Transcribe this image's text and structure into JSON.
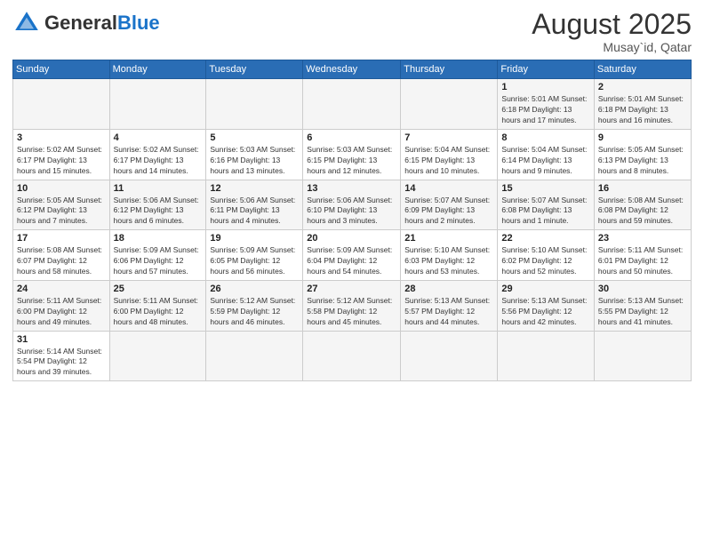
{
  "logo": {
    "text_general": "General",
    "text_blue": "Blue"
  },
  "header": {
    "month": "August 2025",
    "location": "Musay`id, Qatar"
  },
  "weekdays": [
    "Sunday",
    "Monday",
    "Tuesday",
    "Wednesday",
    "Thursday",
    "Friday",
    "Saturday"
  ],
  "weeks": [
    [
      {
        "day": "",
        "info": ""
      },
      {
        "day": "",
        "info": ""
      },
      {
        "day": "",
        "info": ""
      },
      {
        "day": "",
        "info": ""
      },
      {
        "day": "",
        "info": ""
      },
      {
        "day": "1",
        "info": "Sunrise: 5:01 AM\nSunset: 6:18 PM\nDaylight: 13 hours and 17 minutes."
      },
      {
        "day": "2",
        "info": "Sunrise: 5:01 AM\nSunset: 6:18 PM\nDaylight: 13 hours and 16 minutes."
      }
    ],
    [
      {
        "day": "3",
        "info": "Sunrise: 5:02 AM\nSunset: 6:17 PM\nDaylight: 13 hours and 15 minutes."
      },
      {
        "day": "4",
        "info": "Sunrise: 5:02 AM\nSunset: 6:17 PM\nDaylight: 13 hours and 14 minutes."
      },
      {
        "day": "5",
        "info": "Sunrise: 5:03 AM\nSunset: 6:16 PM\nDaylight: 13 hours and 13 minutes."
      },
      {
        "day": "6",
        "info": "Sunrise: 5:03 AM\nSunset: 6:15 PM\nDaylight: 13 hours and 12 minutes."
      },
      {
        "day": "7",
        "info": "Sunrise: 5:04 AM\nSunset: 6:15 PM\nDaylight: 13 hours and 10 minutes."
      },
      {
        "day": "8",
        "info": "Sunrise: 5:04 AM\nSunset: 6:14 PM\nDaylight: 13 hours and 9 minutes."
      },
      {
        "day": "9",
        "info": "Sunrise: 5:05 AM\nSunset: 6:13 PM\nDaylight: 13 hours and 8 minutes."
      }
    ],
    [
      {
        "day": "10",
        "info": "Sunrise: 5:05 AM\nSunset: 6:12 PM\nDaylight: 13 hours and 7 minutes."
      },
      {
        "day": "11",
        "info": "Sunrise: 5:06 AM\nSunset: 6:12 PM\nDaylight: 13 hours and 6 minutes."
      },
      {
        "day": "12",
        "info": "Sunrise: 5:06 AM\nSunset: 6:11 PM\nDaylight: 13 hours and 4 minutes."
      },
      {
        "day": "13",
        "info": "Sunrise: 5:06 AM\nSunset: 6:10 PM\nDaylight: 13 hours and 3 minutes."
      },
      {
        "day": "14",
        "info": "Sunrise: 5:07 AM\nSunset: 6:09 PM\nDaylight: 13 hours and 2 minutes."
      },
      {
        "day": "15",
        "info": "Sunrise: 5:07 AM\nSunset: 6:08 PM\nDaylight: 13 hours and 1 minute."
      },
      {
        "day": "16",
        "info": "Sunrise: 5:08 AM\nSunset: 6:08 PM\nDaylight: 12 hours and 59 minutes."
      }
    ],
    [
      {
        "day": "17",
        "info": "Sunrise: 5:08 AM\nSunset: 6:07 PM\nDaylight: 12 hours and 58 minutes."
      },
      {
        "day": "18",
        "info": "Sunrise: 5:09 AM\nSunset: 6:06 PM\nDaylight: 12 hours and 57 minutes."
      },
      {
        "day": "19",
        "info": "Sunrise: 5:09 AM\nSunset: 6:05 PM\nDaylight: 12 hours and 56 minutes."
      },
      {
        "day": "20",
        "info": "Sunrise: 5:09 AM\nSunset: 6:04 PM\nDaylight: 12 hours and 54 minutes."
      },
      {
        "day": "21",
        "info": "Sunrise: 5:10 AM\nSunset: 6:03 PM\nDaylight: 12 hours and 53 minutes."
      },
      {
        "day": "22",
        "info": "Sunrise: 5:10 AM\nSunset: 6:02 PM\nDaylight: 12 hours and 52 minutes."
      },
      {
        "day": "23",
        "info": "Sunrise: 5:11 AM\nSunset: 6:01 PM\nDaylight: 12 hours and 50 minutes."
      }
    ],
    [
      {
        "day": "24",
        "info": "Sunrise: 5:11 AM\nSunset: 6:00 PM\nDaylight: 12 hours and 49 minutes."
      },
      {
        "day": "25",
        "info": "Sunrise: 5:11 AM\nSunset: 6:00 PM\nDaylight: 12 hours and 48 minutes."
      },
      {
        "day": "26",
        "info": "Sunrise: 5:12 AM\nSunset: 5:59 PM\nDaylight: 12 hours and 46 minutes."
      },
      {
        "day": "27",
        "info": "Sunrise: 5:12 AM\nSunset: 5:58 PM\nDaylight: 12 hours and 45 minutes."
      },
      {
        "day": "28",
        "info": "Sunrise: 5:13 AM\nSunset: 5:57 PM\nDaylight: 12 hours and 44 minutes."
      },
      {
        "day": "29",
        "info": "Sunrise: 5:13 AM\nSunset: 5:56 PM\nDaylight: 12 hours and 42 minutes."
      },
      {
        "day": "30",
        "info": "Sunrise: 5:13 AM\nSunset: 5:55 PM\nDaylight: 12 hours and 41 minutes."
      }
    ],
    [
      {
        "day": "31",
        "info": "Sunrise: 5:14 AM\nSunset: 5:54 PM\nDaylight: 12 hours and 39 minutes."
      },
      {
        "day": "",
        "info": ""
      },
      {
        "day": "",
        "info": ""
      },
      {
        "day": "",
        "info": ""
      },
      {
        "day": "",
        "info": ""
      },
      {
        "day": "",
        "info": ""
      },
      {
        "day": "",
        "info": ""
      }
    ]
  ]
}
